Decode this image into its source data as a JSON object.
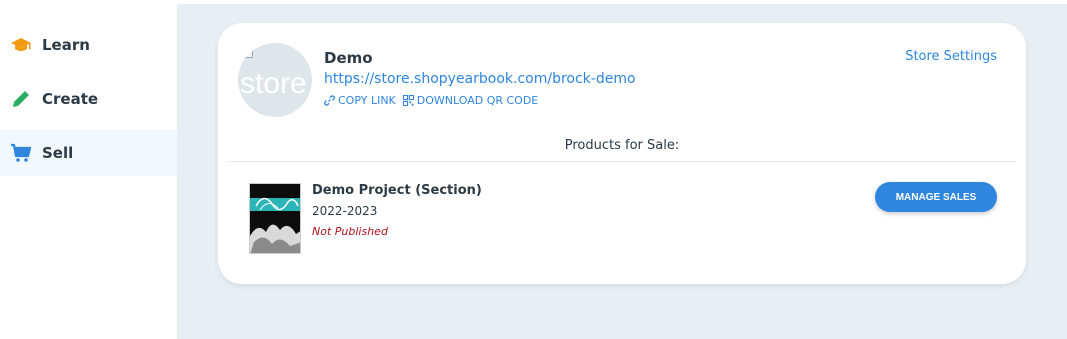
{
  "sidebar": {
    "items": [
      {
        "label": "Learn",
        "icon": "graduation-cap-icon",
        "color": "#f39c12"
      },
      {
        "label": "Create",
        "icon": "pencil-icon",
        "color": "#27ae60"
      },
      {
        "label": "Sell",
        "icon": "shopping-cart-icon",
        "color": "#2e86de",
        "active": true
      }
    ]
  },
  "store": {
    "avatar_alt": "store",
    "name": "Demo",
    "url": "https://store.shopyearbook.com/brock-demo",
    "copy_link_label": "COPY LINK",
    "download_qr_label": "DOWNLOAD QR CODE",
    "settings_label": "Store Settings"
  },
  "products": {
    "heading": "Products for Sale:",
    "items": [
      {
        "title": "Demo Project (Section)",
        "year": "2022-2023",
        "status": "Not Published",
        "action_label": "MANAGE SALES"
      }
    ]
  },
  "colors": {
    "accent": "#2e86de",
    "status_unpublished": "#b3131b",
    "page_background": "#e8eef2"
  }
}
